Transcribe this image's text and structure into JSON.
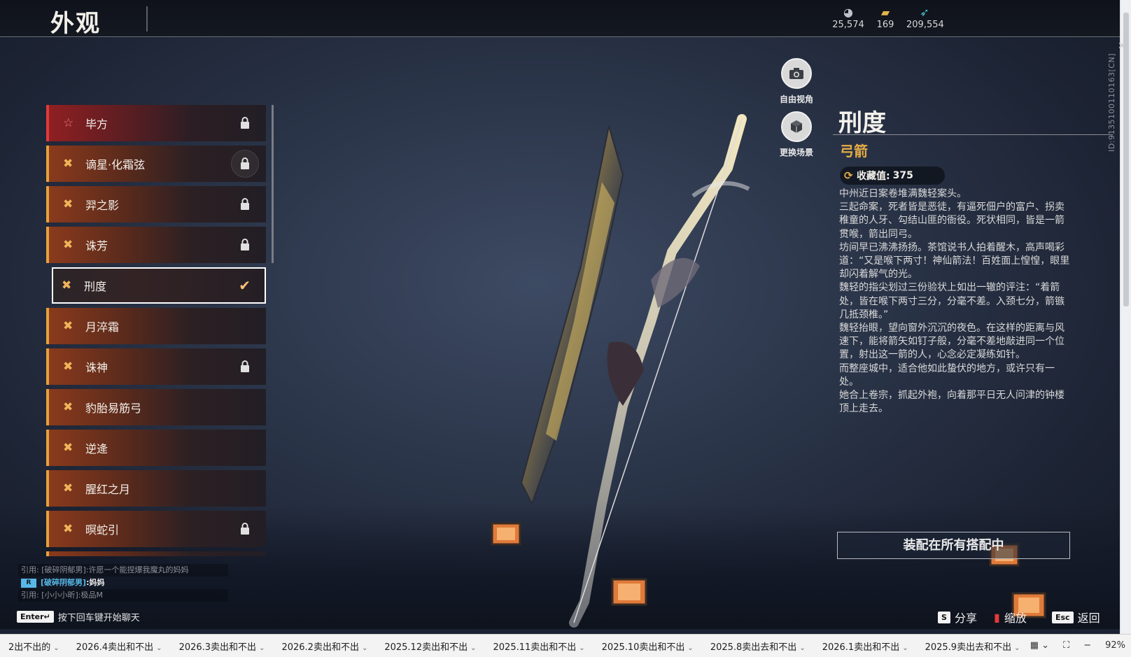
{
  "header": {
    "title": "外观",
    "currencies": [
      {
        "icon": "coin-icon",
        "value": "25,574"
      },
      {
        "icon": "ticket-icon",
        "value": "169"
      },
      {
        "icon": "feather-icon",
        "value": "209,554"
      }
    ],
    "side_id": "ID:9135100110163[CN]"
  },
  "list": {
    "items": [
      {
        "label": "毕方",
        "locked": true,
        "style": "red"
      },
      {
        "label": "谪星·化霜弦",
        "locked": true
      },
      {
        "label": "羿之影",
        "locked": true
      },
      {
        "label": "诛芳",
        "locked": true
      },
      {
        "label": "刑度",
        "selected": true
      },
      {
        "label": "月淬霜"
      },
      {
        "label": "诛神",
        "locked": true
      },
      {
        "label": "豹胎易筋弓"
      },
      {
        "label": "逆逄"
      },
      {
        "label": "腥红之月"
      },
      {
        "label": "暝蛇引",
        "locked": true
      }
    ]
  },
  "camera": {
    "free_view": "自由视角",
    "change_scene": "更换场景"
  },
  "detail": {
    "name": "刑度",
    "type": "弓箭",
    "collection_label": "收藏值:",
    "collection_value": "375",
    "description": [
      "中州近日案卷堆满魏轻案头。",
      "三起命案，死者皆是恶徒，有逼死佃户的富户、拐卖稚童的人牙、勾结山匪的衙役。死状相同，皆是一箭贯喉，箭出同弓。",
      "坊间早已沸沸扬扬。茶馆说书人拍着醒木，高声喝彩道：“又是喉下两寸！神仙箭法！百姓面上惶惶，眼里却闪着解气的光。",
      "魏轻的指尖划过三份验状上如出一辙的评注：“着箭处，皆在喉下两寸三分，分毫不差。入颈七分，箭镞几抵颈椎。”",
      "魏轻抬眼，望向窗外沉沉的夜色。在这样的距离与风速下，能将箭矢如钉子般，分毫不差地敲进同一个位置，射出这一箭的人，心念必定凝练如针。",
      "而整座城中，适合他如此蛰伏的地方，或许只有一处。",
      "她合上卷宗，抓起外袍，向着那平日无人问津的钟楼顶上走去。"
    ],
    "equip_button": "装配在所有搭配中"
  },
  "chat": {
    "quote1": "引用: [破碎阴郁男]:许愿一个能捏爆我魔丸的妈妈",
    "msg_tag": "R",
    "msg_name": "[破碎阴郁男]",
    "msg_text": ":妈妈",
    "quote2": "引用: [小小小昕]:极品M",
    "enter_key": "Enter↵",
    "enter_hint": "按下回车键开始聊天"
  },
  "actions": {
    "share_key": "S",
    "share": "分享",
    "zoom": "缩放",
    "back_key": "Esc",
    "back": "返回"
  },
  "taskbar": {
    "items": [
      "2出不出的",
      "2026.4卖出和不出",
      "2026.3卖出和不出",
      "2026.2卖出和不出",
      "2025.12卖出和不出",
      "2025.11卖出和不出",
      "2025.10卖出和不出",
      "2025.8卖出去和不出",
      "2026.1卖出和不出",
      "2025.9卖出去和不出"
    ],
    "zoom_level": "92%"
  }
}
